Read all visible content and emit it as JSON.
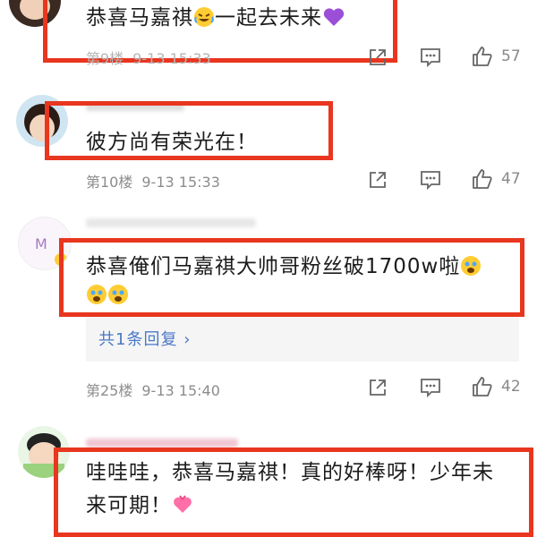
{
  "comments": [
    {
      "text_prefix": "恭喜马嘉祺",
      "text_suffix": "一起去未来",
      "floor": "第9楼",
      "date": "9-13",
      "time": "15:33",
      "likes": "57"
    },
    {
      "text": "彼方尚有荣光在！",
      "floor": "第10楼",
      "date": "9-13",
      "time": "15:33",
      "likes": "47"
    },
    {
      "line1": "恭喜俺们马嘉祺大帅哥粉丝破1700w啦",
      "floor": "第25楼",
      "date": "9-13",
      "time": "15:40",
      "likes": "42",
      "reply_label": "共1条回复",
      "reply_chevron": "›"
    },
    {
      "line1": "哇哇哇，恭喜马嘉祺！真的好棒呀！少年未",
      "line2": "来可期！"
    }
  ],
  "icons": {
    "share": "share-icon",
    "comment": "comment-icon",
    "like": "thumbs-up-icon"
  },
  "colors": {
    "highlight": "#e8361f",
    "link": "#4a78c6",
    "meta": "#8c8c8c"
  }
}
